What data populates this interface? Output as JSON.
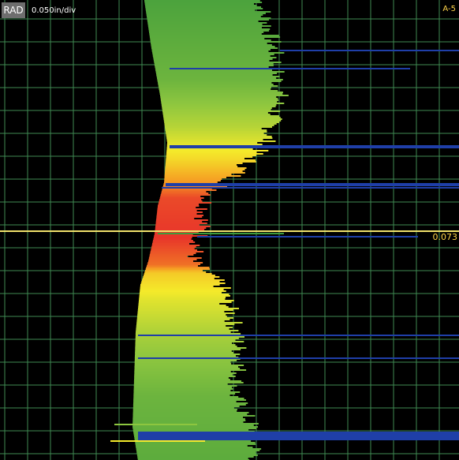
{
  "header": {
    "mode_label": "RAD",
    "scale_label": "0.050in/div",
    "channel_label": "A-5"
  },
  "cursor": {
    "value_label": "0.073"
  },
  "colors": {
    "background": "#000000",
    "grid": "#3f8a52",
    "cursor": "#f0e06a",
    "indication_blue": "#1f3fa8",
    "gradient": [
      "#3c9a3c",
      "#8dc63f",
      "#f4ea2a",
      "#f59a23",
      "#e8352a"
    ]
  },
  "icons": {
    "mode": "rad-mode-badge"
  }
}
